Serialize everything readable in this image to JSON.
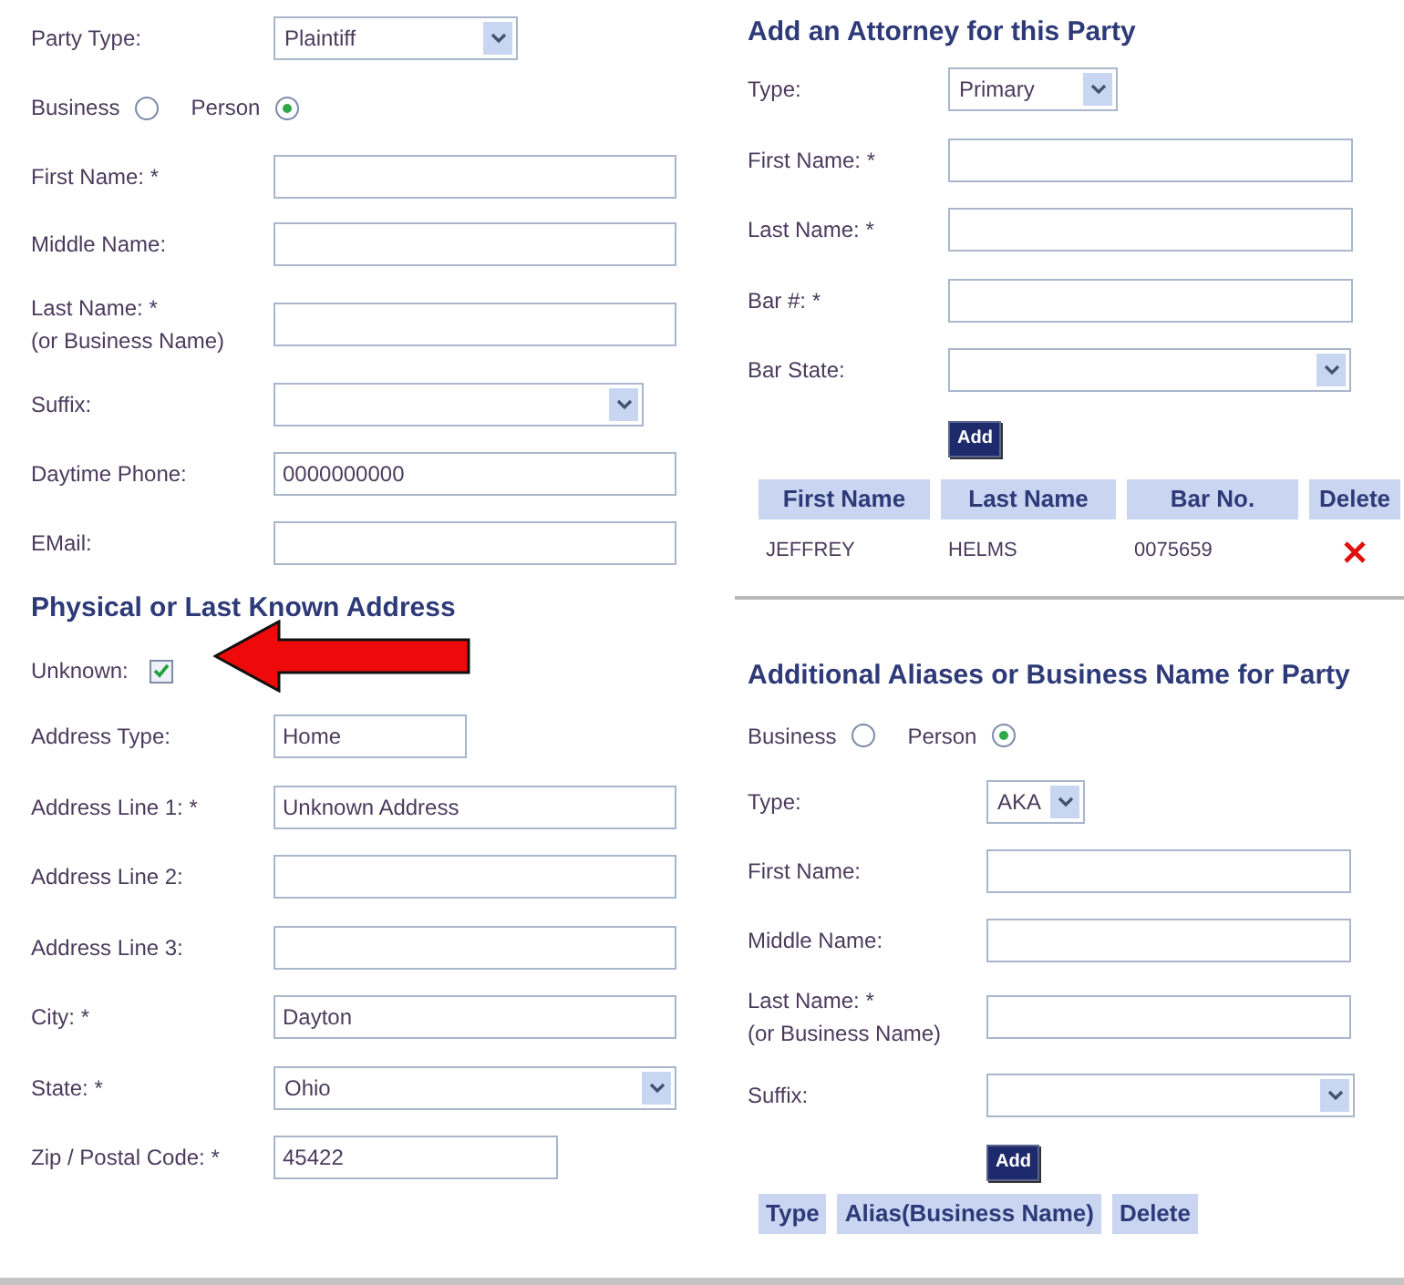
{
  "party": {
    "fields": [
      {
        "kind": "select",
        "label": "Party Type:",
        "value": "Plaintiff"
      },
      {
        "kind": "radios",
        "options": [
          {
            "label": "Business",
            "selected": false
          },
          {
            "label": "Person",
            "selected": true
          }
        ]
      },
      {
        "kind": "text",
        "label": "First Name: *"
      },
      {
        "kind": "text",
        "label": "Middle Name:"
      },
      {
        "kind": "text",
        "label": "Last Name: *",
        "note": "(or Business Name)"
      },
      {
        "kind": "select",
        "label": "Suffix:"
      },
      {
        "kind": "text",
        "label": "Daytime Phone:",
        "value": "0000000000"
      },
      {
        "kind": "text",
        "label": "EMail:"
      }
    ]
  },
  "address": {
    "title": "Physical or Last Known Address",
    "fields": [
      {
        "kind": "checkbox",
        "label": "Unknown:",
        "checked": true
      },
      {
        "kind": "text",
        "label": "Address Type:",
        "value": "Home"
      },
      {
        "kind": "text",
        "label": "Address Line 1: *",
        "value": "Unknown Address"
      },
      {
        "kind": "text",
        "label": "Address Line 2:"
      },
      {
        "kind": "text",
        "label": "Address Line 3:"
      },
      {
        "kind": "text",
        "label": "City: *",
        "value": "Dayton"
      },
      {
        "kind": "select",
        "label": "State: *",
        "value": "Ohio"
      },
      {
        "kind": "text",
        "label": "Zip / Postal Code: *",
        "value": "45422"
      }
    ]
  },
  "attorney": {
    "title": "Add an Attorney for this Party",
    "fields": [
      {
        "kind": "select",
        "label": "Type:",
        "value": "Primary"
      },
      {
        "kind": "text",
        "label": "First Name: *"
      },
      {
        "kind": "text",
        "label": "Last Name: *"
      },
      {
        "kind": "text",
        "label": "Bar #: *"
      },
      {
        "kind": "select",
        "label": "Bar State:"
      }
    ],
    "add_button": "Add",
    "table": {
      "columns": [
        "First Name",
        "Last Name",
        "Bar No.",
        "Delete"
      ],
      "rows": [
        {
          "first_name": "JEFFREY",
          "last_name": "HELMS",
          "bar_no": "0075659"
        }
      ]
    }
  },
  "aliases": {
    "title": "Additional Aliases or Business Name for Party",
    "fields": [
      {
        "kind": "radios",
        "options": [
          {
            "label": "Business",
            "selected": false
          },
          {
            "label": "Person",
            "selected": true
          }
        ]
      },
      {
        "kind": "select",
        "label": "Type:",
        "value": "AKA"
      },
      {
        "kind": "text",
        "label": "First Name:"
      },
      {
        "kind": "text",
        "label": "Middle Name:"
      },
      {
        "kind": "text",
        "label": "Last Name: *",
        "note": "(or Business Name)"
      },
      {
        "kind": "select",
        "label": "Suffix:"
      }
    ],
    "add_button": "Add",
    "table": {
      "columns": [
        "Type",
        "Alias(Business Name)",
        "Delete"
      ]
    }
  }
}
